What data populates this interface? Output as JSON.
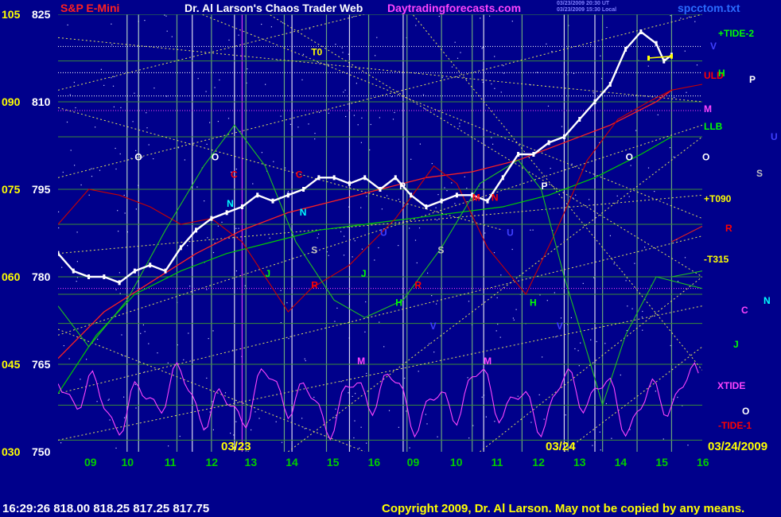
{
  "header": {
    "symbol": "S&P E-Mini",
    "title": "Dr. Al Larson's Chaos Trader Web",
    "site": "Daytradingforecasts.com",
    "stamp1": "03/23/2009 20:30 UT",
    "stamp2": "03/23/2009 15:30 Local",
    "file": "spcctom.txt"
  },
  "footer": {
    "quote": "16:29:26  818.00  818.25  817.25  817.75",
    "copyright": "Copyright 2009, Dr. Al Larson. May not be copied by any means."
  },
  "colors": {
    "background": "#00008b",
    "price": "#ffffff",
    "green_line": "#00cc00",
    "red_line": "#cc0000",
    "magenta": "#ff44ff",
    "yellow": "#ffff00",
    "grid_vertical": "#7cc07c"
  },
  "chart_data": {
    "type": "line",
    "title": "S&P E-Mini",
    "left_axis": {
      "outer_labels": [
        "105",
        "090",
        "075",
        "060",
        "045",
        "030"
      ],
      "inner_labels": [
        "825",
        "810",
        "795",
        "780",
        "765",
        "750"
      ],
      "ylim": [
        750,
        825
      ]
    },
    "x_ticks": [
      "09",
      "10",
      "11",
      "12",
      "13",
      "14",
      "15",
      "16",
      "09",
      "10",
      "11",
      "12",
      "13",
      "14",
      "15",
      "16"
    ],
    "date_labels": [
      "03/23",
      "03/24",
      "03/24/2009"
    ],
    "right_labels": [
      {
        "text": "+TIDE-2",
        "color": "#00ff00"
      },
      {
        "text": "V",
        "color": "#4040ff"
      },
      {
        "text": "ULD",
        "color": "#ff0000"
      },
      {
        "text": "H",
        "color": "#00ff00"
      },
      {
        "text": "P",
        "color": "#ffffff"
      },
      {
        "text": "M",
        "color": "#ff44ff"
      },
      {
        "text": "LLB",
        "color": "#00ff00"
      },
      {
        "text": "U",
        "color": "#4040ff"
      },
      {
        "text": "S",
        "color": "#c0c0c0"
      },
      {
        "text": "+T090",
        "color": "#ffff00"
      },
      {
        "text": "R",
        "color": "#ff0000"
      },
      {
        "text": "-T315",
        "color": "#ffff00"
      },
      {
        "text": "N",
        "color": "#00ffff"
      },
      {
        "text": "C",
        "color": "#ff44ff"
      },
      {
        "text": "J",
        "color": "#00ff00"
      },
      {
        "text": "XTIDE",
        "color": "#ff44ff"
      },
      {
        "text": "O",
        "color": "#ffffff"
      },
      {
        "text": "-TIDE-1",
        "color": "#ff0000"
      }
    ],
    "chart_letters": [
      {
        "text": "T0",
        "x": 3.45,
        "y": 818,
        "color": "#ffff00"
      },
      {
        "text": "T0",
        "x": 11.3,
        "y": 818,
        "color": "#ffff00"
      },
      {
        "text": "O",
        "x": 9.0,
        "y": 800,
        "color": "#ffffff"
      },
      {
        "text": "O",
        "x": 15.4,
        "y": 800,
        "color": "#ffffff"
      },
      {
        "text": "O",
        "x": 10.0,
        "y": 800,
        "color": "#ffffff"
      },
      {
        "text": "O",
        "x": 16.4,
        "y": 800,
        "color": "#ffffff"
      },
      {
        "text": "C",
        "x": 10.25,
        "y": 797,
        "color": "#ff0000"
      },
      {
        "text": "C",
        "x": 11.1,
        "y": 797,
        "color": "#ff0000"
      },
      {
        "text": "P",
        "x": 12.45,
        "y": 795,
        "color": "#ffffff"
      },
      {
        "text": "P",
        "x": 14.3,
        "y": 795,
        "color": "#ffffff"
      },
      {
        "text": "N",
        "x": 10.2,
        "y": 792,
        "color": "#00ffff"
      },
      {
        "text": "N",
        "x": 11.15,
        "y": 790.5,
        "color": "#00ffff"
      },
      {
        "text": "M",
        "x": 13.4,
        "y": 793,
        "color": "#ff0000"
      },
      {
        "text": "N",
        "x": 13.65,
        "y": 793,
        "color": "#ff0000"
      },
      {
        "text": "U",
        "x": 12.2,
        "y": 787,
        "color": "#4040ff"
      },
      {
        "text": "U",
        "x": 13.85,
        "y": 787,
        "color": "#4040ff"
      },
      {
        "text": "S",
        "x": 11.3,
        "y": 784,
        "color": "#c0c0c0"
      },
      {
        "text": "S",
        "x": 12.95,
        "y": 784,
        "color": "#c0c0c0"
      },
      {
        "text": "J",
        "x": 10.7,
        "y": 780,
        "color": "#00ff00"
      },
      {
        "text": "J",
        "x": 11.95,
        "y": 780,
        "color": "#00ff00"
      },
      {
        "text": "R",
        "x": 11.3,
        "y": 778,
        "color": "#ff0000"
      },
      {
        "text": "R",
        "x": 12.65,
        "y": 778,
        "color": "#ff0000"
      },
      {
        "text": "H",
        "x": 12.4,
        "y": 775,
        "color": "#00ff00"
      },
      {
        "text": "H",
        "x": 14.15,
        "y": 775,
        "color": "#00ff00"
      },
      {
        "text": "V",
        "x": 12.85,
        "y": 771,
        "color": "#4040ff"
      },
      {
        "text": "V",
        "x": 14.5,
        "y": 771,
        "color": "#4040ff"
      },
      {
        "text": "M",
        "x": 11.9,
        "y": 765,
        "color": "#ff44ff"
      },
      {
        "text": "M",
        "x": 13.55,
        "y": 765,
        "color": "#ff44ff"
      }
    ],
    "series": [
      {
        "name": "Price",
        "color": "#ffffff",
        "x": [
          8.0,
          8.2,
          8.4,
          8.6,
          8.8,
          9.0,
          9.2,
          9.4,
          9.6,
          9.8,
          10.0,
          10.2,
          10.4,
          10.6,
          10.8,
          11.0,
          11.2,
          11.4,
          11.6,
          11.8,
          12.0,
          12.2,
          12.4,
          12.6,
          12.8,
          13.0,
          13.2,
          13.4,
          13.6,
          13.8,
          14.0,
          14.2,
          14.4,
          14.6,
          14.8,
          15.0,
          15.2,
          15.4,
          15.6,
          15.8,
          15.9,
          16.0
        ],
        "y": [
          784,
          781,
          780,
          780,
          779,
          781,
          782,
          781,
          785,
          788,
          790,
          791,
          792,
          794,
          793,
          794,
          795,
          797,
          797,
          796,
          797,
          795,
          797,
          794,
          792,
          793,
          794,
          794,
          793,
          797,
          801,
          801,
          803,
          804,
          807,
          810,
          813,
          819,
          822,
          820,
          817,
          818
        ]
      },
      {
        "name": "T0",
        "color": "#ffff00",
        "x": [
          15.7,
          16.0
        ],
        "y": [
          817.5,
          817.8
        ]
      }
    ]
  }
}
